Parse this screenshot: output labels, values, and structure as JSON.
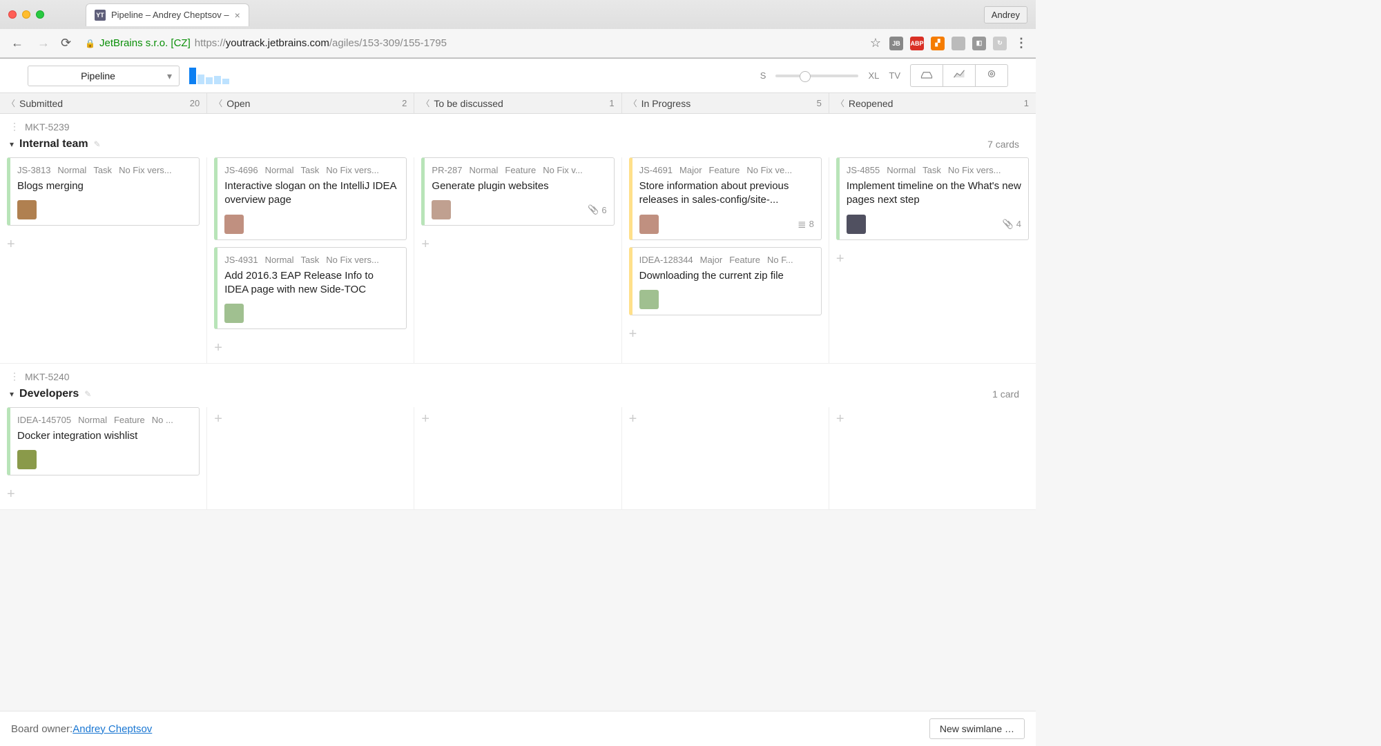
{
  "browser": {
    "tab_title": "Pipeline – Andrey Cheptsov –",
    "user": "Andrey",
    "url_org": "JetBrains s.r.o. [CZ]",
    "url_proto": "https://",
    "url_host": "youtrack.jetbrains.com",
    "url_path": "/agiles/153-309/155-1795"
  },
  "toolbar": {
    "board_name": "Pipeline",
    "size_s": "S",
    "size_xl": "XL",
    "tv": "TV"
  },
  "columns": [
    {
      "name": "Submitted",
      "count": "20"
    },
    {
      "name": "Open",
      "count": "2"
    },
    {
      "name": "To be discussed",
      "count": "1"
    },
    {
      "name": "In Progress",
      "count": "5"
    },
    {
      "name": "Reopened",
      "count": "1"
    }
  ],
  "swimlanes": [
    {
      "key": "MKT-5239",
      "title": "Internal team",
      "cards_label": "7 cards",
      "columns": [
        [
          {
            "id": "JS-3813",
            "priority": "Normal",
            "type": "Task",
            "fix": "No Fix vers...",
            "title": "Blogs merging",
            "color": "green",
            "avatar": "#b08050"
          }
        ],
        [
          {
            "id": "JS-4696",
            "priority": "Normal",
            "type": "Task",
            "fix": "No Fix vers...",
            "title": "Interactive slogan on the IntelliJ IDEA overview page",
            "color": "green",
            "avatar": "#c09080"
          },
          {
            "id": "JS-4931",
            "priority": "Normal",
            "type": "Task",
            "fix": "No Fix vers...",
            "title": "Add 2016.3 EAP Release Info to IDEA page with new Side-TOC",
            "color": "green",
            "avatar": "#a0c090"
          }
        ],
        [
          {
            "id": "PR-287",
            "priority": "Normal",
            "type": "Feature",
            "fix": "No Fix v...",
            "title": "Generate plugin websites",
            "color": "green",
            "avatar": "#c0a090",
            "attachments": "6",
            "attach_type": "clip"
          }
        ],
        [
          {
            "id": "JS-4691",
            "priority": "Major",
            "type": "Feature",
            "fix": "No Fix ve...",
            "title": "Store information about previous releases in sales-config/site-...",
            "color": "yellow",
            "avatar": "#c09080",
            "attachments": "8",
            "attach_type": "list"
          },
          {
            "id": "IDEA-128344",
            "priority": "Major",
            "type": "Feature",
            "fix": "No F...",
            "title": "Downloading the current zip file",
            "color": "yellow",
            "avatar": "#a0c090"
          }
        ],
        [
          {
            "id": "JS-4855",
            "priority": "Normal",
            "type": "Task",
            "fix": "No Fix vers...",
            "title": "Implement timeline on the What's new pages next step",
            "color": "green",
            "avatar": "#505060",
            "attachments": "4",
            "attach_type": "clip"
          }
        ]
      ]
    },
    {
      "key": "MKT-5240",
      "title": "Developers",
      "cards_label": "1 card",
      "columns": [
        [
          {
            "id": "IDEA-145705",
            "priority": "Normal",
            "type": "Feature",
            "fix": "No ...",
            "title": "Docker integration wishlist",
            "color": "green",
            "avatar": "#8a9a4a"
          }
        ],
        [],
        [],
        [],
        []
      ]
    }
  ],
  "footer": {
    "owner_label": "Board owner: ",
    "owner_name": "Andrey Cheptsov",
    "new_swimlane": "New swimlane …"
  }
}
